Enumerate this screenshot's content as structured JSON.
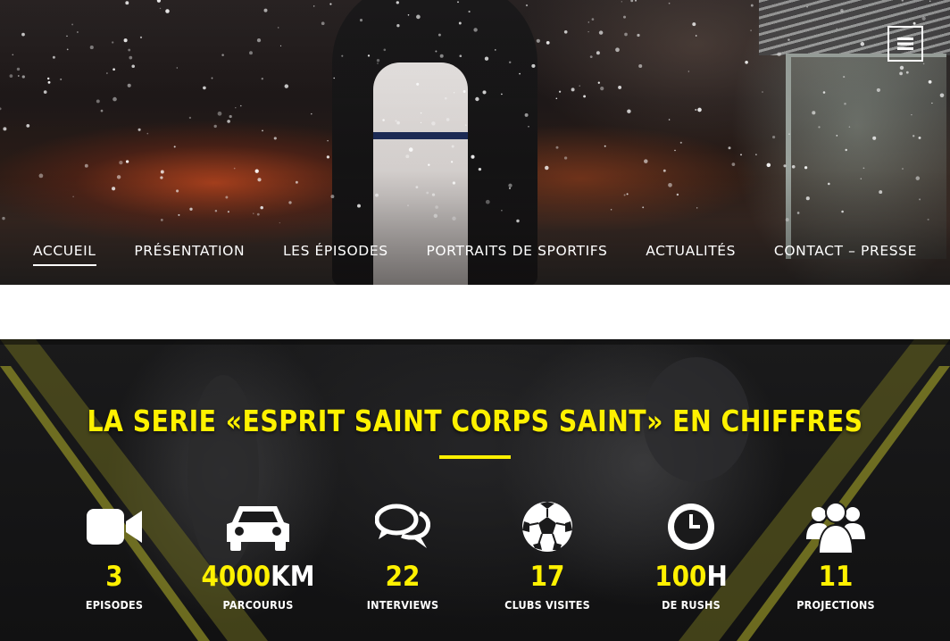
{
  "header": {
    "menu_icon": "hamburger-menu-icon"
  },
  "nav": {
    "items": [
      {
        "label": "ACCUEIL",
        "active": true
      },
      {
        "label": "PRÉSENTATION",
        "active": false
      },
      {
        "label": "LES ÉPISODES",
        "active": false
      },
      {
        "label": "PORTRAITS DE SPORTIFS",
        "active": false
      },
      {
        "label": "ACTUALITÉS",
        "active": false
      },
      {
        "label": "CONTACT – PRESSE",
        "active": false
      }
    ]
  },
  "stats": {
    "title": "LA SERIE «ESPRIT SAINT CORPS SAINT» EN CHIFFRES",
    "accent_color": "#fff100",
    "items": [
      {
        "icon": "video-camera-icon",
        "value": "3",
        "unit": "",
        "label": "EPISODES"
      },
      {
        "icon": "car-icon",
        "value": "4000",
        "unit": "KM",
        "label": "PARCOURUS"
      },
      {
        "icon": "speech-bubbles-icon",
        "value": "22",
        "unit": "",
        "label": "INTERVIEWS"
      },
      {
        "icon": "soccer-ball-icon",
        "value": "17",
        "unit": "",
        "label": "CLUBS VISITES"
      },
      {
        "icon": "clock-icon",
        "value": "100",
        "unit": "H",
        "label": "DE RUSHS"
      },
      {
        "icon": "users-group-icon",
        "value": "11",
        "unit": "",
        "label": "PROJECTIONS"
      }
    ]
  }
}
